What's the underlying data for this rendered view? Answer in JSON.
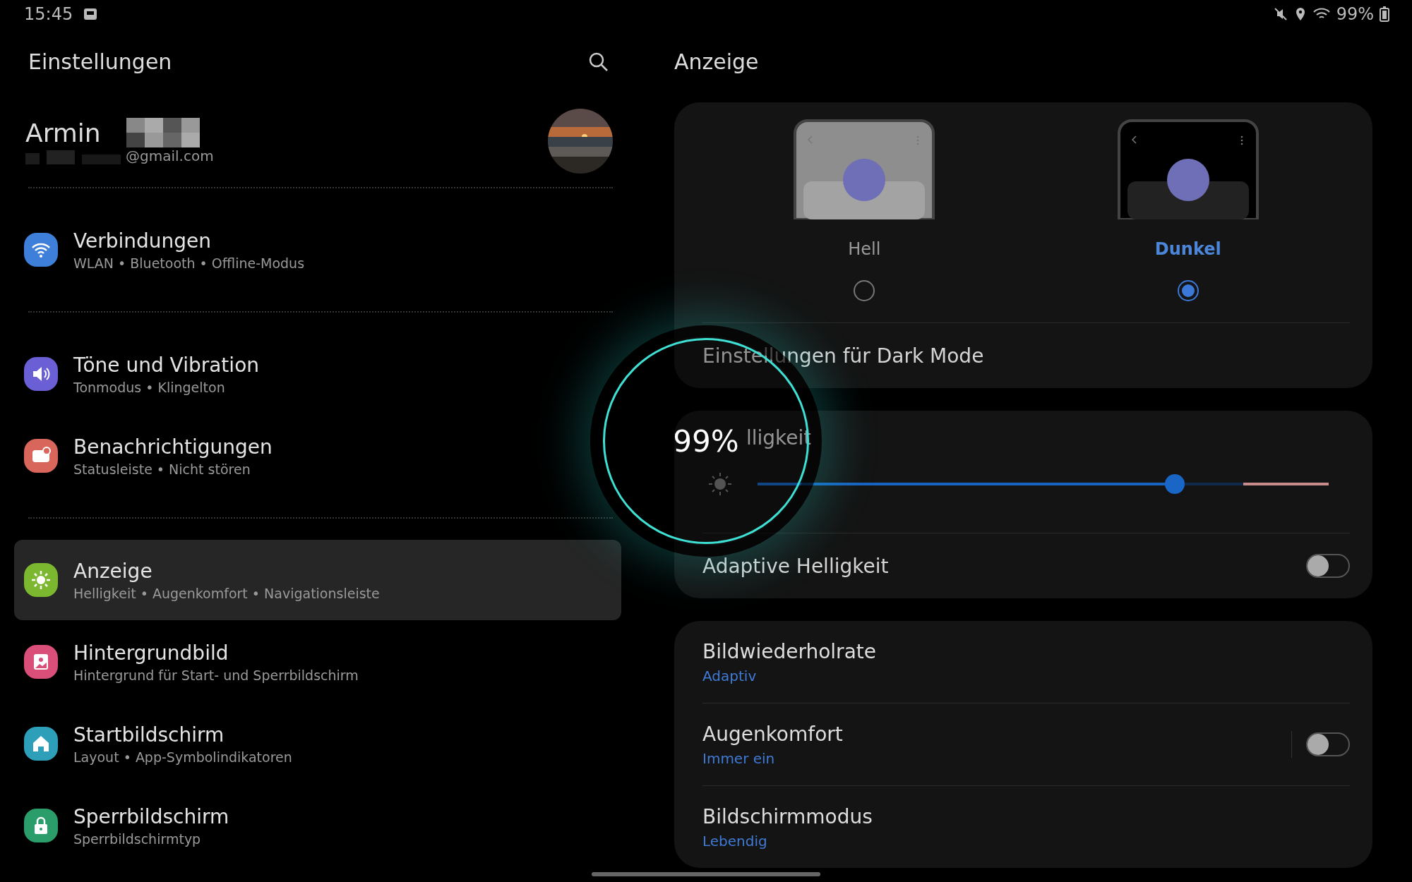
{
  "status_bar": {
    "time": "15:45",
    "battery": "99%"
  },
  "sidebar": {
    "title": "Einstellungen",
    "profile": {
      "name": "Armin",
      "email": "@gmail.com"
    },
    "groups": [
      [
        {
          "title": "Verbindungen",
          "subtitle": "WLAN • Bluetooth • Offline-Modus",
          "color": "#3d7fd9",
          "selected": false
        }
      ],
      [
        {
          "title": "Töne und Vibration",
          "subtitle": "Tonmodus • Klingelton",
          "color": "#6b5fd6",
          "selected": false
        },
        {
          "title": "Benachrichtigungen",
          "subtitle": "Statusleiste • Nicht stören",
          "color": "#d9665a",
          "selected": false
        }
      ],
      [
        {
          "title": "Anzeige",
          "subtitle": "Helligkeit • Augenkomfort • Navigationsleiste",
          "color": "#7cb82f",
          "selected": true
        },
        {
          "title": "Hintergrundbild",
          "subtitle": "Hintergrund für Start- und Sperrbildschirm",
          "color": "#d94f7a",
          "selected": false
        },
        {
          "title": "Startbildschirm",
          "subtitle": "Layout • App-Symbolindikatoren",
          "color": "#2e9fb8",
          "selected": false
        },
        {
          "title": "Sperrbildschirm",
          "subtitle": "Sperrbildschirmtyp",
          "color": "#2a9d6a",
          "selected": false
        }
      ]
    ]
  },
  "page": {
    "title": "Anzeige",
    "themes": [
      {
        "label": "Hell",
        "kind": "light",
        "selected": false
      },
      {
        "label": "Dunkel",
        "kind": "dark",
        "selected": true
      }
    ],
    "dark_mode_settings": "Einstellungen für Dark Mode",
    "brightness": {
      "label": "lligkeit",
      "level": 0.73
    },
    "adaptive_brightness": {
      "label": "Adaptive Helligkeit",
      "on": false
    },
    "options": [
      {
        "title": "Bildwiederholrate",
        "value": "Adaptiv",
        "kind": "plain"
      },
      {
        "title": "Augenkomfort",
        "value": "Immer ein",
        "kind": "toggle",
        "on": false
      },
      {
        "title": "Bildschirmmodus",
        "value": "Lebendig",
        "kind": "plain"
      }
    ]
  },
  "volume_overlay": {
    "reading": "99%"
  }
}
